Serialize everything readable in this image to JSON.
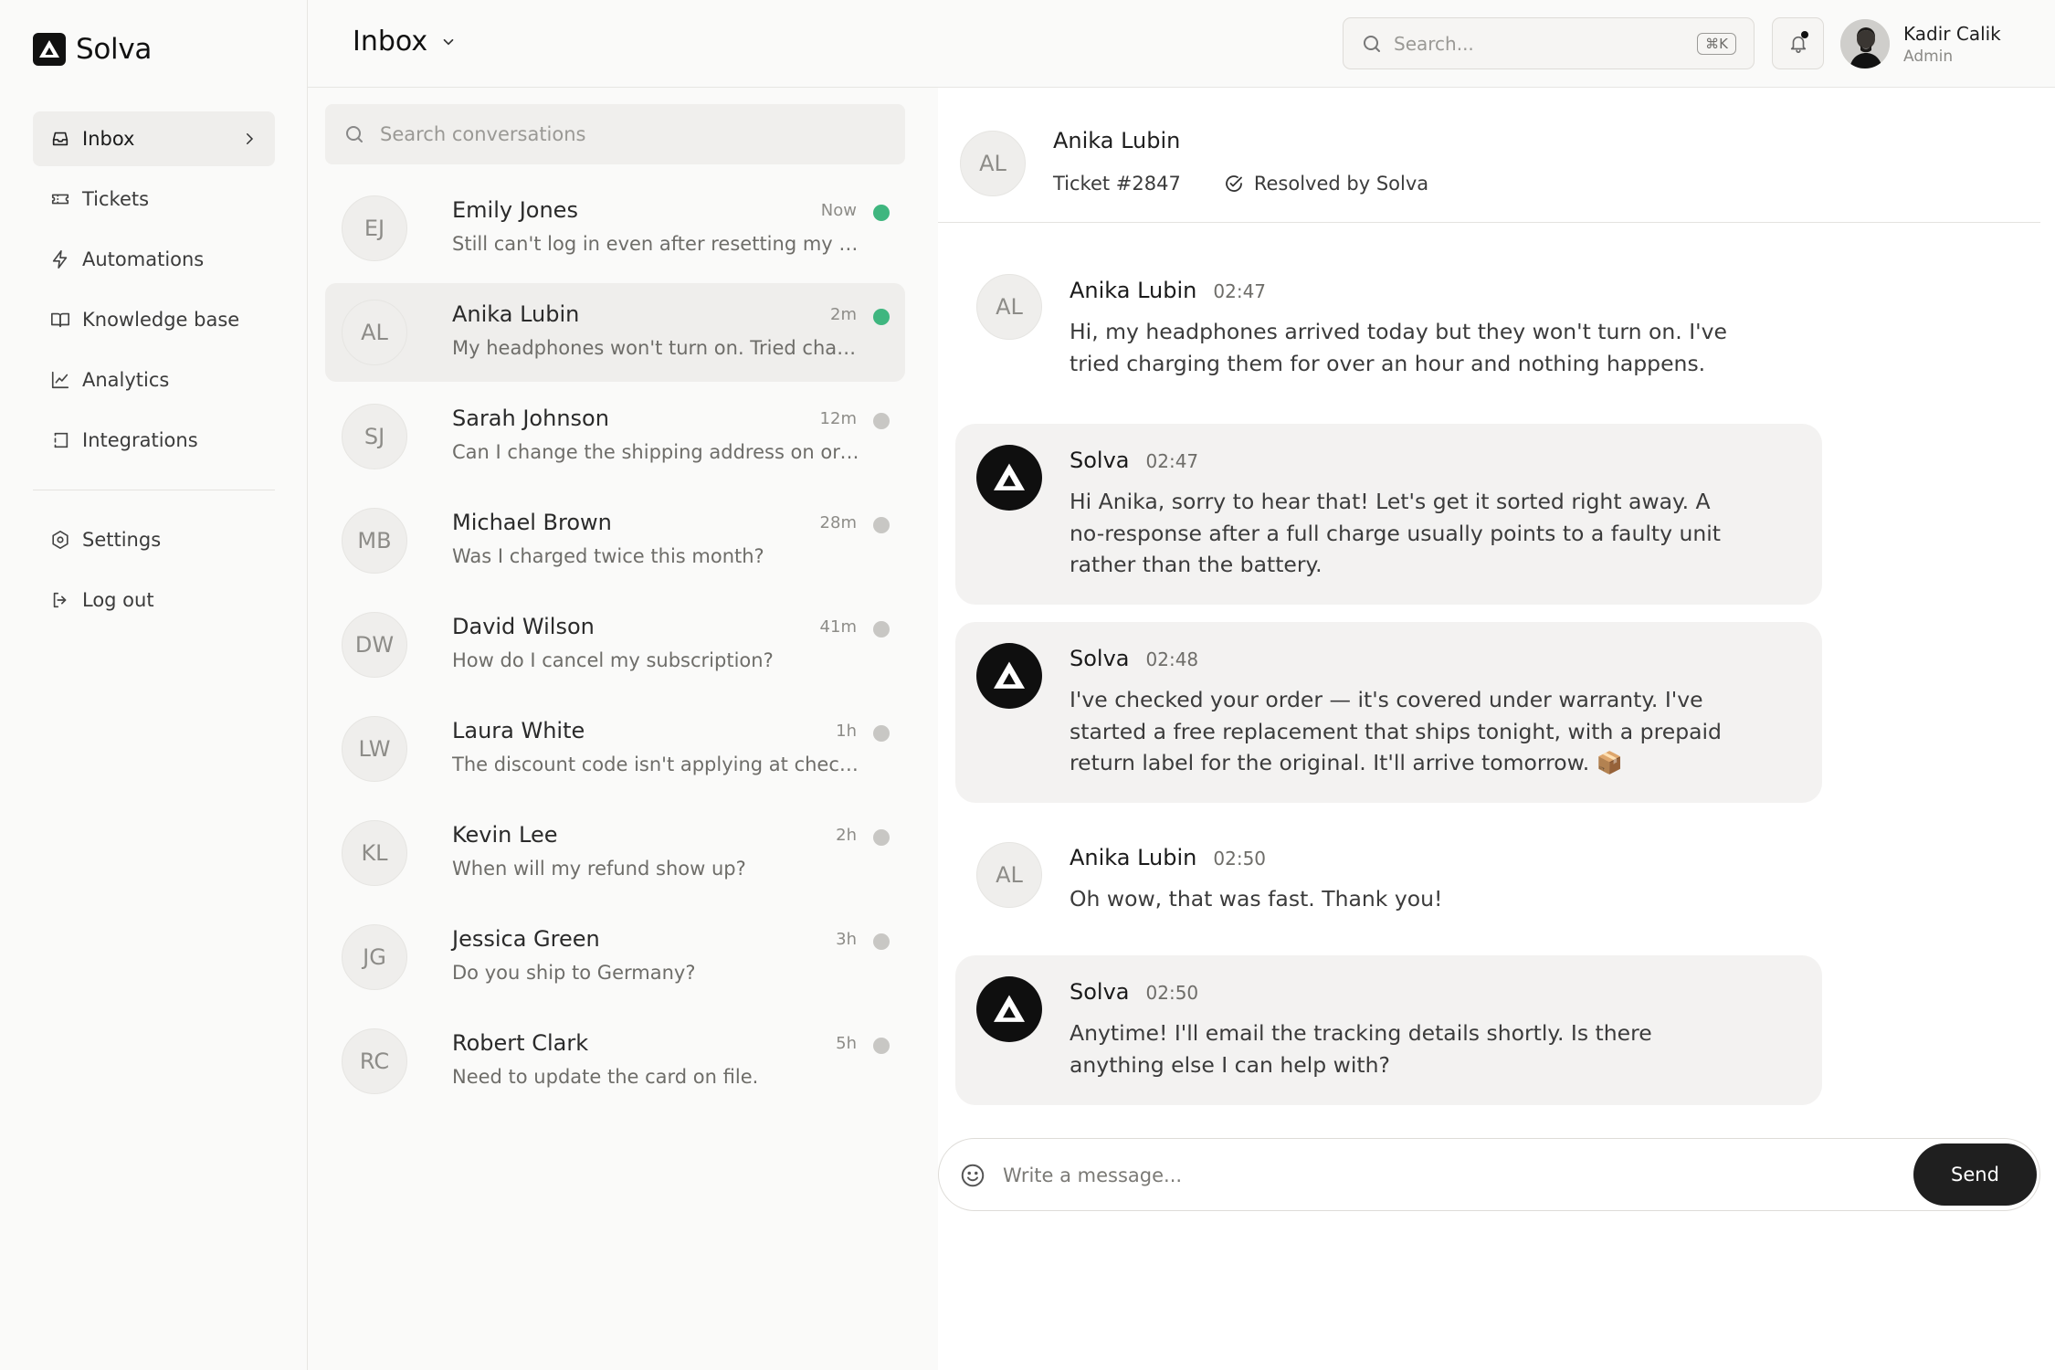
{
  "brand": {
    "name": "Solva"
  },
  "sidebar": {
    "items": [
      {
        "label": "Inbox",
        "icon": "inbox-icon",
        "active": true
      },
      {
        "label": "Tickets",
        "icon": "ticket-icon"
      },
      {
        "label": "Automations",
        "icon": "bolt-icon"
      },
      {
        "label": "Knowledge base",
        "icon": "book-icon"
      },
      {
        "label": "Analytics",
        "icon": "chart-line-icon"
      },
      {
        "label": "Integrations",
        "icon": "integrations-icon"
      }
    ],
    "bottom_items": [
      {
        "label": "Settings",
        "icon": "gear-icon"
      },
      {
        "label": "Log out",
        "icon": "logout-icon"
      }
    ]
  },
  "header": {
    "title": "Inbox",
    "search_placeholder": "Search...",
    "search_shortcut": "⌘K",
    "user": {
      "name": "Kadir Calik",
      "role": "Admin"
    }
  },
  "conversations": {
    "search_placeholder": "Search conversations",
    "items": [
      {
        "initials": "EJ",
        "name": "Emily Jones",
        "time": "Now",
        "preview": "Still can't log in even after resetting my pas...",
        "online": true
      },
      {
        "initials": "AL",
        "name": "Anika Lubin",
        "time": "2m",
        "preview": "My headphones won't turn on. Tried charg...",
        "online": true,
        "active": true
      },
      {
        "initials": "SJ",
        "name": "Sarah Johnson",
        "time": "12m",
        "preview": "Can I change the shipping address on order...",
        "online": false
      },
      {
        "initials": "MB",
        "name": "Michael Brown",
        "time": "28m",
        "preview": "Was I charged twice this month?",
        "online": false
      },
      {
        "initials": "DW",
        "name": "David Wilson",
        "time": "41m",
        "preview": "How do I cancel my subscription?",
        "online": false
      },
      {
        "initials": "LW",
        "name": "Laura White",
        "time": "1h",
        "preview": "The discount code isn't applying at checko...",
        "online": false
      },
      {
        "initials": "KL",
        "name": "Kevin Lee",
        "time": "2h",
        "preview": "When will my refund show up?",
        "online": false
      },
      {
        "initials": "JG",
        "name": "Jessica Green",
        "time": "3h",
        "preview": "Do you ship to Germany?",
        "online": false
      },
      {
        "initials": "RC",
        "name": "Robert Clark",
        "time": "5h",
        "preview": "Need to update the card on file.",
        "online": false
      }
    ]
  },
  "chat": {
    "initials": "AL",
    "name": "Anika Lubin",
    "ticket": "Ticket #2847",
    "status": "Resolved by Solva",
    "messages": [
      {
        "from": "user",
        "sender": "Anika Lubin",
        "initials": "AL",
        "time": "02:47",
        "text": "Hi, my headphones arrived today but they won't turn on. I've tried charging them for over an hour and nothing happens."
      },
      {
        "from": "bot",
        "sender": "Solva",
        "time": "02:47",
        "text": "Hi Anika, sorry to hear that! Let's get it sorted right away. A no-response after a full charge usually points to a faulty unit rather than the battery."
      },
      {
        "from": "bot",
        "sender": "Solva",
        "time": "02:48",
        "text": "I've checked your order — it's covered under warranty. I've started a free replacement that ships tonight, with a prepaid return label for the original. It'll arrive tomorrow. 📦"
      },
      {
        "from": "user",
        "sender": "Anika Lubin",
        "initials": "AL",
        "time": "02:50",
        "text": "Oh wow, that was fast. Thank you!"
      },
      {
        "from": "bot",
        "sender": "Solva",
        "time": "02:50",
        "text": "Anytime! I'll email the tracking details shortly. Is there anything else I can help with?"
      }
    ],
    "composer_placeholder": "Write a message...",
    "send_label": "Send"
  }
}
